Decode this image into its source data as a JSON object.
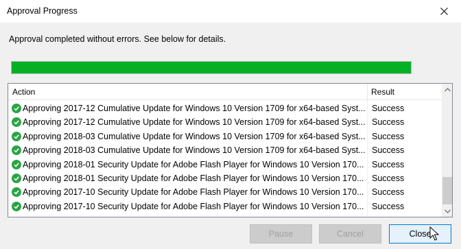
{
  "window": {
    "title": "Approval Progress",
    "close_icon": "close-icon"
  },
  "message": "Approval completed without errors. See below for details.",
  "progress": {
    "percent": 100,
    "color": "#06b025"
  },
  "list": {
    "columns": {
      "action": "Action",
      "result": "Result"
    },
    "rows": [
      {
        "action": "Approving 2017-12 Cumulative Update for Windows 10 Version 1709 for x64-based Syst...",
        "result": "Success"
      },
      {
        "action": "Approving 2017-12 Cumulative Update for Windows 10 Version 1709 for x64-based Syst...",
        "result": "Success"
      },
      {
        "action": "Approving 2018-03 Cumulative Update for Windows 10 Version 1709 for x64-based Syst...",
        "result": "Success"
      },
      {
        "action": "Approving 2018-03 Cumulative Update for Windows 10 Version 1709 for x64-based Syst...",
        "result": "Success"
      },
      {
        "action": "Approving 2018-01 Security Update for Adobe Flash Player for Windows 10 Version 170...",
        "result": "Success"
      },
      {
        "action": "Approving 2018-01 Security Update for Adobe Flash Player for Windows 10 Version 170...",
        "result": "Success"
      },
      {
        "action": "Approving 2017-10 Security Update for Adobe Flash Player for Windows 10 Version 170...",
        "result": "Success"
      },
      {
        "action": "Approving 2017-10 Security Update for Adobe Flash Player for Windows 10 Version 170...",
        "result": "Success"
      }
    ],
    "row_icon": "success-check-icon",
    "scrollbar_position": "bottom"
  },
  "buttons": {
    "pause": "Pause",
    "cancel": "Cancel",
    "close": "Close"
  },
  "colors": {
    "accent": "#0078d7",
    "success": "#29a545"
  }
}
